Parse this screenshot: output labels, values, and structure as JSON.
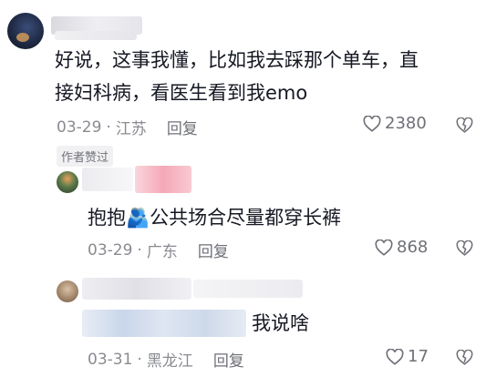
{
  "comments": [
    {
      "text_line1": "好说，这事我懂，比如我去踩那个单车，直",
      "text_line2": "接妇科病，看医生看到我emo",
      "date": "03-29",
      "location": "江苏",
      "reply_label": "回复",
      "like_count": "2380"
    },
    {
      "badge": "作者赞过",
      "text": "抱抱🫂公共场合尽量都穿长裤",
      "date": "03-29",
      "location": "广东",
      "reply_label": "回复",
      "like_count": "868"
    },
    {
      "text": "我说啥",
      "date": "03-31",
      "location": "黑龙江",
      "reply_label": "回复",
      "like_count": "17"
    }
  ],
  "meta_separator": "·",
  "icons": {
    "like": "heart-outline-icon",
    "dislike": "broken-heart-icon"
  },
  "colors": {
    "text": "#161823",
    "meta": "#8a8b91",
    "badge_bg": "#f1f1f3"
  }
}
